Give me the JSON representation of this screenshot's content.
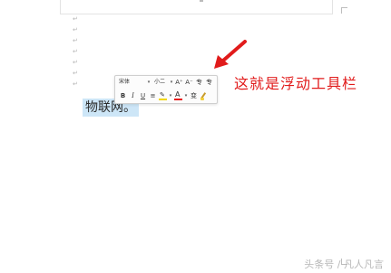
{
  "document": {
    "paragraph_mark_glyph": "↵",
    "paragraph_mark_count": 7,
    "selected_text": "物联网。",
    "selection_color": "#cde6f7"
  },
  "floating_toolbar": {
    "font_name": "宋体",
    "font_size": "小二",
    "grow_font_label": "A⁺",
    "shrink_font_label": "A⁻",
    "decrease_indent_label": "专",
    "increase_indent_label": "专",
    "bold_label": "B",
    "italic_label": "I",
    "underline_label": "U",
    "align_label": "≡",
    "font_color_label": "A",
    "phonetic_label": "变",
    "highlight_color": "#f2d700",
    "font_color": "#e81b1b",
    "icons": [
      "grow-font-icon",
      "shrink-font-icon",
      "decrease-indent-icon",
      "increase-indent-icon",
      "align-icon",
      "highlight-icon",
      "font-color-icon",
      "phonetic-guide-icon",
      "format-painter-icon"
    ]
  },
  "annotation": {
    "text": "这就是浮动工具栏",
    "color": "#e11b1b"
  },
  "watermark": {
    "text": "头条号 / 凡人凡言"
  }
}
